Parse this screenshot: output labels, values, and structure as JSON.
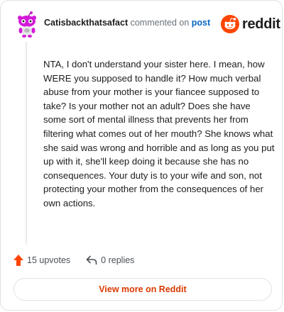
{
  "comment": {
    "username": "Catisbackthatsafact",
    "action_text": "commented on",
    "post_link": "post",
    "body": "NTA, I don't understand your sister here. I mean, how WERE you supposed to handle it? How much verbal abuse from your mother is your fiancee supposed to take? Is your mother not an adult? Does she have some sort of mental illness that prevents her from filtering what comes out of her mouth? She knows what she said was wrong and horrible and as long as you put up with it, she'll keep doing it because she has no consequences. Your duty is to your wife and son, not protecting your mother from the consequences of her own actions."
  },
  "brand": {
    "wordmark": "reddit",
    "logo_icon": "reddit-alien-icon",
    "accent_color": "#ff4500"
  },
  "actions": {
    "upvotes": "15 upvotes",
    "replies": "0 replies",
    "upvote_icon": "upvote-arrow-icon",
    "reply_icon": "reply-arrow-icon",
    "upvote_color": "#ff4500"
  },
  "footer": {
    "view_more": "View more on Reddit",
    "view_more_color": "#d93a00"
  }
}
